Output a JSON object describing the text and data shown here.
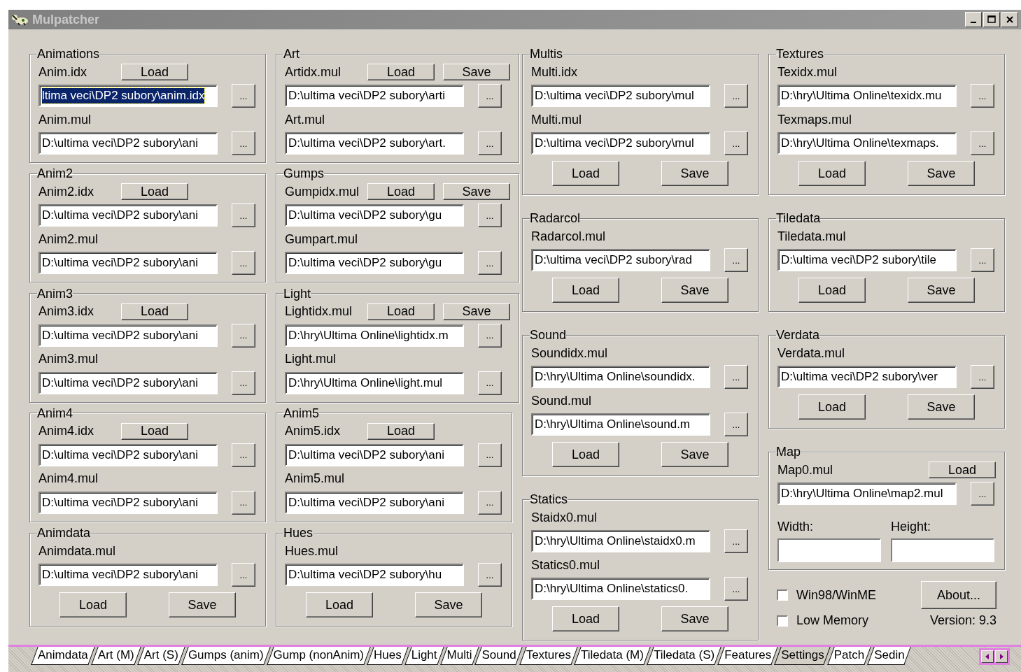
{
  "window": {
    "title": "Mulpatcher"
  },
  "columns": [
    [
      {
        "title": "Animations",
        "kind": "inline",
        "buttons": [
          "Load"
        ],
        "files": [
          {
            "label": "Anim.idx",
            "value": "ltima veci\\DP2 subory\\anim.idx",
            "selected": true,
            "browse": "..."
          },
          {
            "label": "Anim.mul",
            "value": "D:\\ultima veci\\DP2 subory\\ani",
            "selected": false,
            "browse": "..."
          }
        ]
      },
      {
        "title": "Anim2",
        "kind": "inline",
        "buttons": [
          "Load"
        ],
        "files": [
          {
            "label": "Anim2.idx",
            "value": "D:\\ultima veci\\DP2 subory\\ani",
            "selected": false,
            "browse": "..."
          },
          {
            "label": "Anim2.mul",
            "value": "D:\\ultima veci\\DP2 subory\\ani",
            "selected": false,
            "browse": "..."
          }
        ]
      },
      {
        "title": "Anim3",
        "kind": "inline",
        "buttons": [
          "Load"
        ],
        "files": [
          {
            "label": "Anim3.idx",
            "value": "D:\\ultima veci\\DP2 subory\\ani",
            "selected": false,
            "browse": "..."
          },
          {
            "label": "Anim3.mul",
            "value": "D:\\ultima veci\\DP2 subory\\ani",
            "selected": false,
            "browse": "..."
          }
        ]
      },
      {
        "title": "Anim4",
        "kind": "inline",
        "buttons": [
          "Load"
        ],
        "files": [
          {
            "label": "Anim4.idx",
            "value": "D:\\ultima veci\\DP2 subory\\ani",
            "selected": false,
            "browse": "..."
          },
          {
            "label": "Anim4.mul",
            "value": "D:\\ultima veci\\DP2 subory\\ani",
            "selected": false,
            "browse": "..."
          }
        ]
      },
      {
        "title": "Animdata",
        "kind": "bottom",
        "buttons": [
          "Load",
          "Save"
        ],
        "files": [
          {
            "label": "Animdata.mul",
            "value": "D:\\ultima veci\\DP2 subory\\ani",
            "selected": false,
            "browse": "..."
          }
        ]
      }
    ],
    [
      {
        "title": "Art",
        "kind": "inline",
        "buttons": [
          "Load",
          "Save"
        ],
        "files": [
          {
            "label": "Artidx.mul",
            "value": "D:\\ultima veci\\DP2 subory\\arti",
            "selected": false,
            "browse": "..."
          },
          {
            "label": "Art.mul",
            "value": "D:\\ultima veci\\DP2 subory\\art.",
            "selected": false,
            "browse": "..."
          }
        ]
      },
      {
        "title": "Gumps",
        "kind": "inline",
        "buttons": [
          "Load",
          "Save"
        ],
        "files": [
          {
            "label": "Gumpidx.mul",
            "value": "D:\\ultima veci\\DP2 subory\\gu",
            "selected": false,
            "browse": "..."
          },
          {
            "label": "Gumpart.mul",
            "value": "D:\\ultima veci\\DP2 subory\\gu",
            "selected": false,
            "browse": "..."
          }
        ]
      },
      {
        "title": "Light",
        "kind": "inline",
        "buttons": [
          "Load",
          "Save"
        ],
        "files": [
          {
            "label": "Lightidx.mul",
            "value": "D:\\hry\\Ultima Online\\lightidx.m",
            "selected": false,
            "browse": "..."
          },
          {
            "label": "Light.mul",
            "value": "D:\\hry\\Ultima Online\\light.mul",
            "selected": false,
            "browse": "..."
          }
        ]
      },
      {
        "title": "Anim5",
        "kind": "inline",
        "buttons": [
          "Load"
        ],
        "files": [
          {
            "label": "Anim5.idx",
            "value": "D:\\ultima veci\\DP2 subory\\ani",
            "selected": false,
            "browse": "..."
          },
          {
            "label": "Anim5.mul",
            "value": "D:\\ultima veci\\DP2 subory\\ani",
            "selected": false,
            "browse": "..."
          }
        ]
      },
      {
        "title": "Hues",
        "kind": "bottom",
        "buttons": [
          "Load",
          "Save"
        ],
        "files": [
          {
            "label": "Hues.mul",
            "value": "D:\\ultima veci\\DP2 subory\\hu",
            "selected": false,
            "browse": "..."
          }
        ]
      }
    ],
    [
      {
        "title": "Multis",
        "kind": "bottom",
        "buttons": [
          "Load",
          "Save"
        ],
        "files": [
          {
            "label": "Multi.idx",
            "value": "D:\\ultima veci\\DP2 subory\\mul",
            "selected": false,
            "browse": "..."
          },
          {
            "label": "Multi.mul",
            "value": "D:\\ultima veci\\DP2 subory\\mul",
            "selected": false,
            "browse": "..."
          }
        ]
      },
      {
        "title": "Radarcol",
        "kind": "bottom",
        "buttons": [
          "Load",
          "Save"
        ],
        "files": [
          {
            "label": "Radarcol.mul",
            "value": "D:\\ultima veci\\DP2 subory\\rad",
            "selected": false,
            "browse": "..."
          }
        ]
      },
      {
        "title": "Sound",
        "kind": "bottom",
        "buttons": [
          "Load",
          "Save"
        ],
        "files": [
          {
            "label": "Soundidx.mul",
            "value": "D:\\hry\\Ultima Online\\soundidx.",
            "selected": false,
            "browse": "..."
          },
          {
            "label": "Sound.mul",
            "value": "D:\\hry\\Ultima Online\\sound.m",
            "selected": false,
            "browse": "..."
          }
        ]
      },
      {
        "title": "Statics",
        "kind": "bottom",
        "buttons": [
          "Load",
          "Save"
        ],
        "files": [
          {
            "label": "Staidx0.mul",
            "value": "D:\\hry\\Ultima Online\\staidx0.m",
            "selected": false,
            "browse": "..."
          },
          {
            "label": "Statics0.mul",
            "value": "D:\\hry\\Ultima Online\\statics0.",
            "selected": false,
            "browse": "..."
          }
        ]
      }
    ],
    [
      {
        "title": "Textures",
        "kind": "bottom",
        "buttons": [
          "Load",
          "Save"
        ],
        "files": [
          {
            "label": "Texidx.mul",
            "value": "D:\\hry\\Ultima Online\\texidx.mu",
            "selected": false,
            "browse": "..."
          },
          {
            "label": "Texmaps.mul",
            "value": "D:\\hry\\Ultima Online\\texmaps.",
            "selected": false,
            "browse": "..."
          }
        ]
      },
      {
        "title": "Tiledata",
        "kind": "bottom",
        "buttons": [
          "Load",
          "Save"
        ],
        "files": [
          {
            "label": "Tiledata.mul",
            "value": "D:\\ultima veci\\DP2 subory\\tile",
            "selected": false,
            "browse": "..."
          }
        ]
      },
      {
        "title": "Verdata",
        "kind": "bottom",
        "buttons": [
          "Load",
          "Save"
        ],
        "files": [
          {
            "label": "Verdata.mul",
            "value": "D:\\ultima veci\\DP2 subory\\ver",
            "selected": false,
            "browse": "..."
          }
        ]
      },
      {
        "title": "Map",
        "kind": "inline",
        "buttons": [
          "Load"
        ],
        "files": [
          {
            "label": "Map0.mul",
            "value": "D:\\hry\\Ultima Online\\map2.mul",
            "selected": false,
            "browse": "..."
          }
        ],
        "size_fields": [
          "Width:",
          "Height:"
        ]
      }
    ]
  ],
  "options": {
    "checkboxes": [
      {
        "label": "Win98/WinME",
        "checked": false
      },
      {
        "label": "Low Memory",
        "checked": false
      }
    ],
    "about_button": "About...",
    "version": "Version: 9.3"
  },
  "tabs": [
    {
      "label": "Animdata",
      "selected": false
    },
    {
      "label": "Art (M)",
      "selected": false
    },
    {
      "label": "Art (S)",
      "selected": false
    },
    {
      "label": "Gumps (anim)",
      "selected": false
    },
    {
      "label": "Gump (nonAnim)",
      "selected": false
    },
    {
      "label": "Hues",
      "selected": false
    },
    {
      "label": "Light",
      "selected": false
    },
    {
      "label": "Multi",
      "selected": false
    },
    {
      "label": "Sound",
      "selected": false
    },
    {
      "label": "Textures",
      "selected": false
    },
    {
      "label": "Tiledata (M)",
      "selected": false
    },
    {
      "label": "Tiledata (S)",
      "selected": false
    },
    {
      "label": "Features",
      "selected": false
    },
    {
      "label": "Settings",
      "selected": true
    },
    {
      "label": "Patch",
      "selected": false
    },
    {
      "label": "Sedin",
      "selected": false
    }
  ]
}
